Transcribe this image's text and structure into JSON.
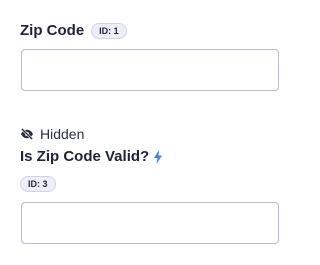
{
  "fields": [
    {
      "label": "Zip Code",
      "id_badge": "ID: 1",
      "value": "",
      "placeholder": ""
    },
    {
      "visibility": "Hidden",
      "label": "Is Zip Code Valid?",
      "id_badge": "ID: 3",
      "value": "",
      "placeholder": "",
      "icons": [
        "eye-slash-icon",
        "lightning-bolt-icon"
      ]
    }
  ],
  "colors": {
    "text": "#1f2338",
    "badge_bg": "#eceef9",
    "badge_border": "#cfd3ea",
    "input_border": "#b8bcd0",
    "bolt": "#3b82f6"
  }
}
